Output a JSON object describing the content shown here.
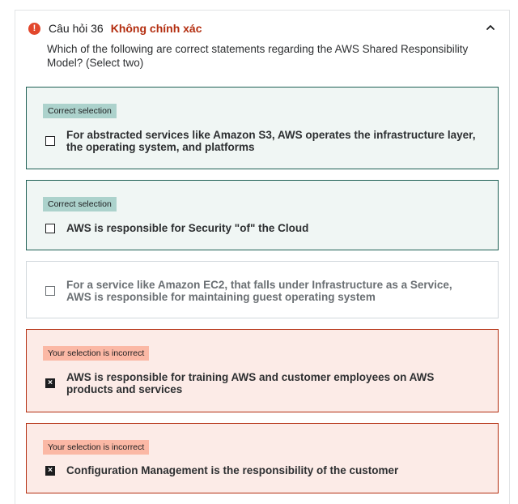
{
  "question": {
    "number_label": "Câu hỏi 36",
    "status_label": "Không chính xác",
    "status_icon": "error-circle-icon",
    "collapse_icon": "chevron-up-icon",
    "prompt": "Which of the following are correct statements regarding the AWS Shared Responsibility Model? (Select two)"
  },
  "options": [
    {
      "state": "correct",
      "tag": "Correct selection",
      "checked": false,
      "text": "For abstracted services like Amazon S3, AWS operates the infrastructure layer, the operating system, and platforms"
    },
    {
      "state": "correct",
      "tag": "Correct selection",
      "checked": false,
      "text": "AWS is responsible for Security \"of\" the Cloud"
    },
    {
      "state": "neutral",
      "tag": "",
      "checked": false,
      "text": "For a service like Amazon EC2, that falls under Infrastructure as a Service, AWS is responsible for maintaining guest operating system"
    },
    {
      "state": "wrong",
      "tag": "Your selection is incorrect",
      "checked": true,
      "text": "AWS is responsible for training AWS and customer employees on AWS products and services"
    },
    {
      "state": "wrong",
      "tag": "Your selection is incorrect",
      "checked": true,
      "text": "Configuration Management is the responsibility of the customer"
    }
  ],
  "colors": {
    "correct_border": "#1e6055",
    "correct_bg": "#f0f6f4",
    "correct_tag": "#acd2cc",
    "wrong_border": "#b32d0f",
    "wrong_bg": "#fcebe7",
    "wrong_tag": "#fbb8a5",
    "error_icon": "#e2472c"
  }
}
